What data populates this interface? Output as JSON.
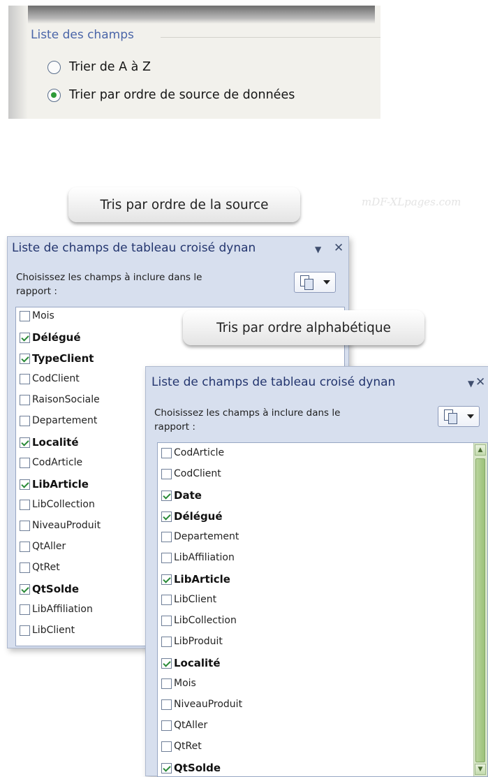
{
  "sort_options": {
    "legend": "Liste des champs",
    "option_az": "Trier de A à Z",
    "option_source": "Trier par ordre de source de données",
    "selected": "option_source"
  },
  "banners": {
    "source_order": "Tris par ordre de la source",
    "alpha_order": "Tris par ordre alphabétique"
  },
  "watermark": "mDF-XLpages.com",
  "panel_left": {
    "title": "Liste de champs de tableau croisé dynan",
    "hint": "Choisissez les champs à inclure dans le rapport :",
    "fields": [
      {
        "label": "Mois",
        "checked": false
      },
      {
        "label": "Délégué",
        "checked": true
      },
      {
        "label": "TypeClient",
        "checked": true
      },
      {
        "label": "CodClient",
        "checked": false
      },
      {
        "label": "RaisonSociale",
        "checked": false
      },
      {
        "label": "Departement",
        "checked": false
      },
      {
        "label": "Localité",
        "checked": true
      },
      {
        "label": "CodArticle",
        "checked": false
      },
      {
        "label": "LibArticle",
        "checked": true
      },
      {
        "label": "LibCollection",
        "checked": false
      },
      {
        "label": "NiveauProduit",
        "checked": false
      },
      {
        "label": "QtAller",
        "checked": false
      },
      {
        "label": "QtRet",
        "checked": false
      },
      {
        "label": "QtSolde",
        "checked": true
      },
      {
        "label": "LibAffiliation",
        "checked": false
      },
      {
        "label": "LibClient",
        "checked": false
      }
    ]
  },
  "panel_right": {
    "title": "Liste de champs de tableau croisé dynan",
    "hint": "Choisissez les champs à inclure dans le rapport :",
    "fields": [
      {
        "label": "CodArticle",
        "checked": false
      },
      {
        "label": "CodClient",
        "checked": false
      },
      {
        "label": "Date",
        "checked": true
      },
      {
        "label": "Délégué",
        "checked": true
      },
      {
        "label": "Departement",
        "checked": false
      },
      {
        "label": "LibAffiliation",
        "checked": false
      },
      {
        "label": "LibArticle",
        "checked": true
      },
      {
        "label": "LibClient",
        "checked": false
      },
      {
        "label": "LibCollection",
        "checked": false
      },
      {
        "label": "LibProduit",
        "checked": false
      },
      {
        "label": "Localité",
        "checked": true
      },
      {
        "label": "Mois",
        "checked": false
      },
      {
        "label": "NiveauProduit",
        "checked": false
      },
      {
        "label": "QtAller",
        "checked": false
      },
      {
        "label": "QtRet",
        "checked": false
      },
      {
        "label": "QtSolde",
        "checked": true
      }
    ]
  }
}
